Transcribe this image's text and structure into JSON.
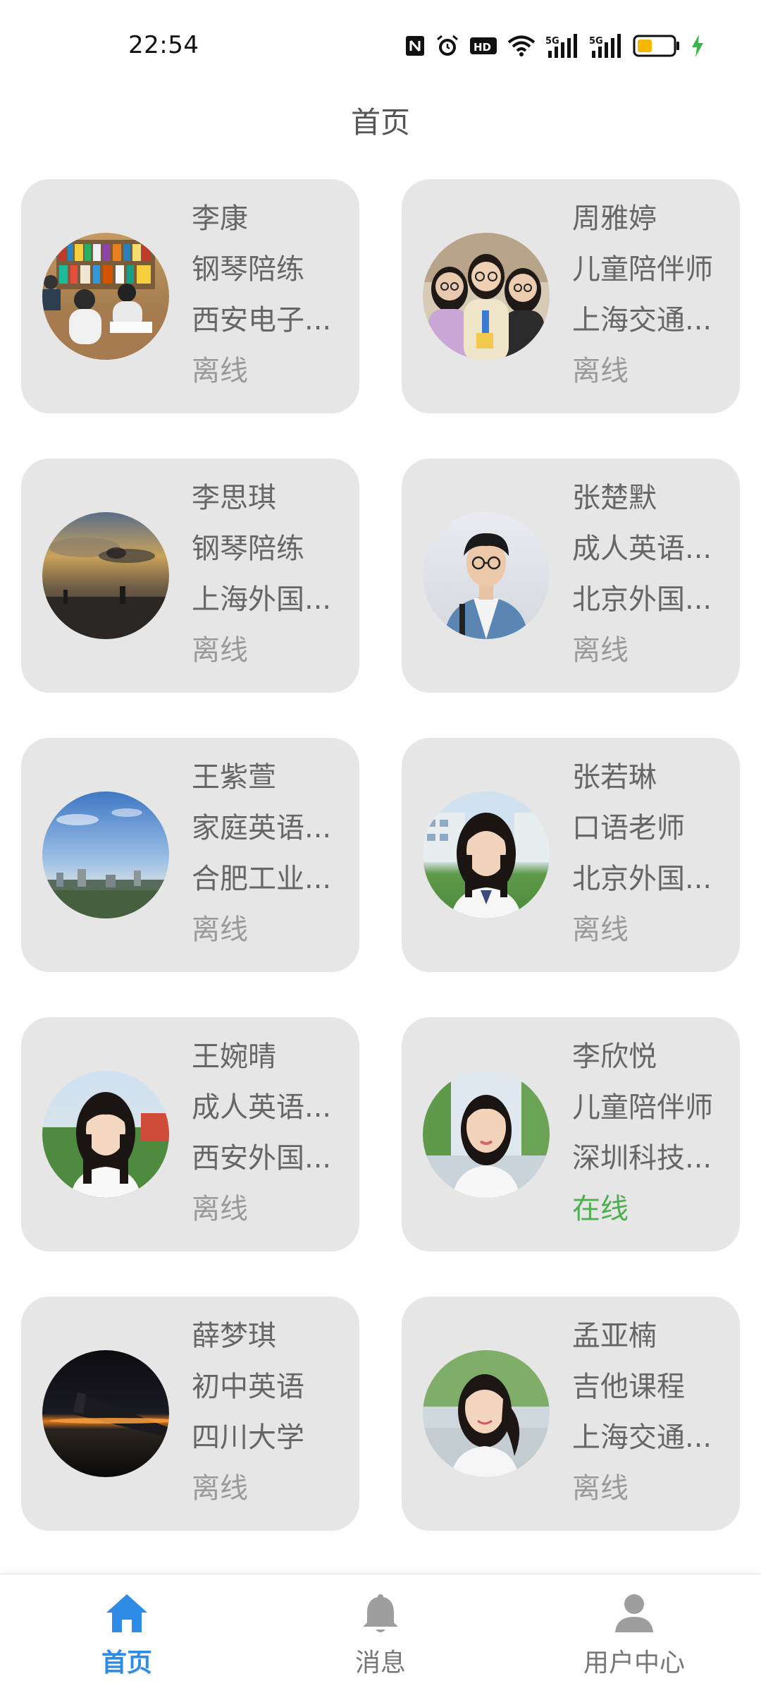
{
  "status_bar": {
    "time": "22:54",
    "icons": [
      "nfc-icon",
      "alarm-icon",
      "hd-icon",
      "wifi-icon",
      "signal-5g-icon",
      "signal-5g-icon",
      "battery-icon",
      "charging-icon"
    ]
  },
  "page_title": "首页",
  "cards": [
    {
      "name": "李康",
      "course": "钢琴陪练",
      "school": "西安电子...",
      "status": "离线",
      "online": false,
      "avatar": "library-photo"
    },
    {
      "name": "周雅婷",
      "course": "儿童陪伴师",
      "school": "上海交通...",
      "status": "离线",
      "online": false,
      "avatar": "three-women-photo"
    },
    {
      "name": "李思琪",
      "course": "钢琴陪练",
      "school": "上海外国...",
      "status": "离线",
      "online": false,
      "avatar": "sunset-sky-photo"
    },
    {
      "name": "张楚默",
      "course": "成人英语...",
      "school": "北京外国...",
      "status": "离线",
      "online": false,
      "avatar": "young-man-photo"
    },
    {
      "name": "王紫萱",
      "course": "家庭英语...",
      "school": "合肥工业...",
      "status": "离线",
      "online": false,
      "avatar": "city-sky-photo"
    },
    {
      "name": "张若琳",
      "course": "口语老师",
      "school": "北京外国...",
      "status": "离线",
      "online": false,
      "avatar": "girl-portrait-photo"
    },
    {
      "name": "王婉晴",
      "course": "成人英语...",
      "school": "西安外国...",
      "status": "离线",
      "online": false,
      "avatar": "girl-portrait-photo"
    },
    {
      "name": "李欣悦",
      "course": "儿童陪伴师",
      "school": "深圳科技...",
      "status": "在线",
      "online": true,
      "avatar": "woman-portrait-photo"
    },
    {
      "name": "薛梦琪",
      "course": "初中英语",
      "school": "四川大学",
      "status": "离线",
      "online": false,
      "avatar": "airplane-wing-photo"
    },
    {
      "name": "孟亚楠",
      "course": "吉他课程",
      "school": "上海交通...",
      "status": "离线",
      "online": false,
      "avatar": "girl-portrait-photo"
    }
  ],
  "bottom_nav": {
    "items": [
      {
        "label": "首页",
        "icon": "home-icon",
        "active": true
      },
      {
        "label": "消息",
        "icon": "bell-icon",
        "active": false
      },
      {
        "label": "用户中心",
        "icon": "user-icon",
        "active": false
      }
    ]
  },
  "colors": {
    "card_bg": "#e6e6e6",
    "active": "#2e8be6",
    "online": "#4caf50",
    "offline": "#9a9a9a",
    "battery": "#f5b800",
    "charging": "#3cb44b"
  }
}
